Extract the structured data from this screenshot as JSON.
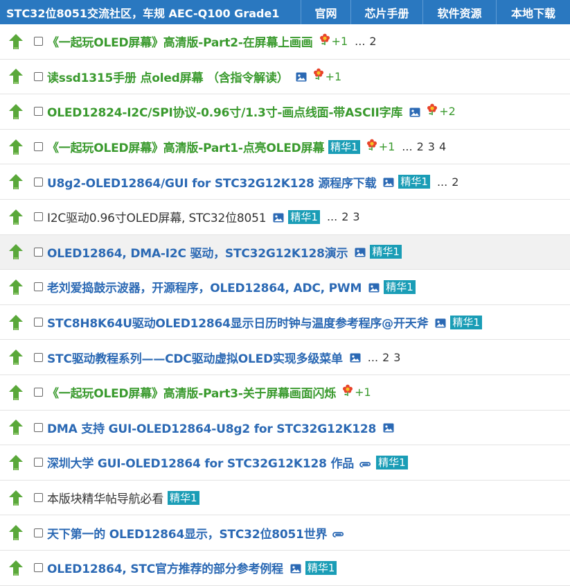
{
  "header": {
    "site_title": "STC32位8051交流社区，车规 AEC-Q100 Grade1",
    "nav": [
      "官网",
      "芯片手册",
      "软件资源",
      "本地下载"
    ]
  },
  "colors": {
    "header_bg": "#2a78c0",
    "green_title": "#3a9a2e",
    "blue_title": "#2b69b4",
    "badge": "#1a9db6"
  },
  "threads": [
    {
      "title": "《一起玩OLED屏幕》高清版-Part2-在屏幕上画画",
      "color": "green",
      "image": false,
      "attach": false,
      "digest": "",
      "rating": "+1",
      "pages": [
        "2"
      ]
    },
    {
      "title": "读ssd1315手册 点oled屏幕 （含指令解读）",
      "color": "green",
      "image": true,
      "attach": false,
      "digest": "",
      "rating": "+1",
      "pages": []
    },
    {
      "title": "OLED12824-I2C/SPI协议-0.96寸/1.3寸-画点线面-带ASCII字库",
      "color": "green",
      "image": true,
      "attach": false,
      "digest": "",
      "rating": "+2",
      "pages": []
    },
    {
      "title": "《一起玩OLED屏幕》高清版-Part1-点亮OLED屏幕",
      "color": "green",
      "image": false,
      "attach": false,
      "digest": "精华1",
      "rating": "+1",
      "pages": [
        "2",
        "3",
        "4"
      ]
    },
    {
      "title": "U8g2-OLED12864/GUI for STC32G12K128 源程序下载",
      "color": "blue",
      "image": true,
      "attach": false,
      "digest": "精华1",
      "rating": "",
      "pages": [
        "2"
      ]
    },
    {
      "title": "I2C驱动0.96寸OLED屏幕, STC32位8051",
      "color": "plain",
      "image": true,
      "attach": false,
      "digest": "精华1",
      "rating": "",
      "pages": [
        "2",
        "3"
      ]
    },
    {
      "title": "OLED12864, DMA-I2C 驱动，STC32G12K128演示",
      "color": "blue",
      "image": true,
      "attach": false,
      "digest": "精华1",
      "rating": "",
      "pages": [],
      "highlight": true
    },
    {
      "title": "老刘爱捣鼓示波器，开源程序，OLED12864, ADC, PWM",
      "color": "blue",
      "image": true,
      "attach": false,
      "digest": "精华1",
      "rating": "",
      "pages": []
    },
    {
      "title": "STC8H8K64U驱动OLED12864显示日历时钟与温度参考程序@开天斧",
      "color": "blue",
      "image": true,
      "attach": false,
      "digest": "精华1",
      "rating": "",
      "pages": []
    },
    {
      "title": "STC驱动教程系列——CDC驱动虚拟OLED实现多级菜单",
      "color": "blue",
      "image": true,
      "attach": false,
      "digest": "",
      "rating": "",
      "pages": [
        "2",
        "3"
      ]
    },
    {
      "title": "《一起玩OLED屏幕》高清版-Part3-关于屏幕画面闪烁",
      "color": "green",
      "image": false,
      "attach": false,
      "digest": "",
      "rating": "+1",
      "pages": []
    },
    {
      "title": "DMA 支持 GUI-OLED12864-U8g2 for STC32G12K128",
      "color": "blue",
      "image": true,
      "attach": false,
      "digest": "",
      "rating": "",
      "pages": []
    },
    {
      "title": "深圳大学 GUI-OLED12864 for STC32G12K128 作品",
      "color": "blue",
      "image": false,
      "attach": true,
      "digest": "精华1",
      "rating": "",
      "pages": []
    },
    {
      "title": "本版块精华帖导航必看",
      "color": "plain",
      "image": false,
      "attach": false,
      "digest": "精华1",
      "rating": "",
      "pages": []
    },
    {
      "title": "天下第一的 OLED12864显示，STC32位8051世界",
      "color": "blue",
      "image": false,
      "attach": true,
      "digest": "",
      "rating": "",
      "pages": []
    },
    {
      "title": "OLED12864, STC官方推荐的部分参考例程",
      "color": "blue",
      "image": true,
      "attach": false,
      "digest": "精华1",
      "rating": "",
      "pages": []
    }
  ]
}
